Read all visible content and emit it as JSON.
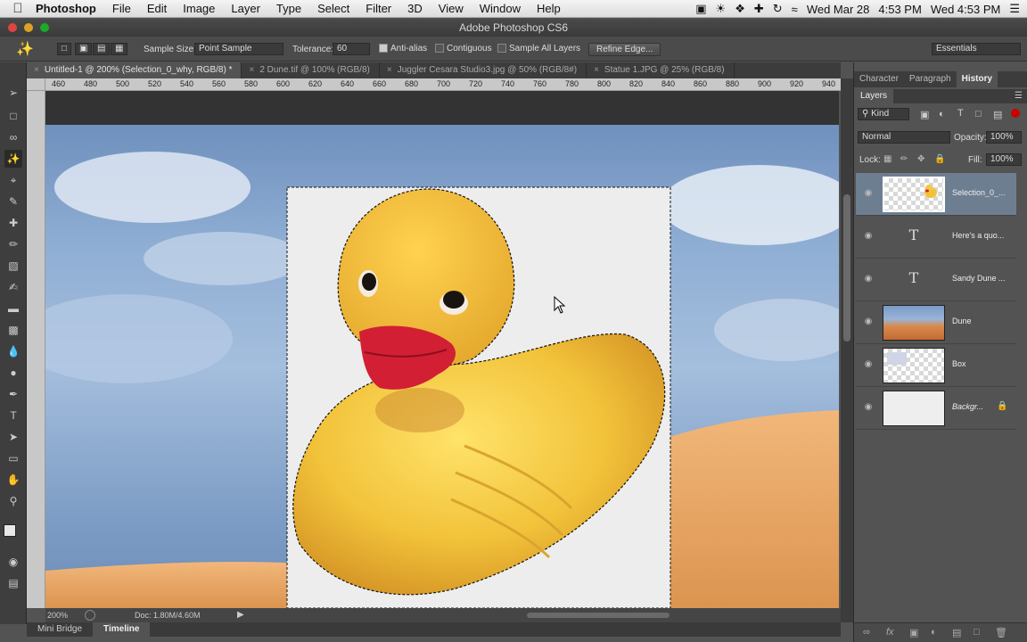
{
  "menubar": {
    "app": "Photoshop",
    "menus": [
      "File",
      "Edit",
      "Image",
      "Layer",
      "Type",
      "Select",
      "Filter",
      "3D",
      "View",
      "Window",
      "Help"
    ],
    "date1": "Wed Mar 28",
    "time1": "4:53 PM",
    "clock2": "Wed 4:53 PM"
  },
  "window": {
    "title": "Adobe Photoshop CS6"
  },
  "options": {
    "sample_size_label": "Sample Size:",
    "sample_size_value": "Point Sample",
    "tolerance_label": "Tolerance:",
    "tolerance_value": "60",
    "anti_alias": "Anti-alias",
    "contiguous": "Contiguous",
    "sample_all_layers": "Sample All Layers",
    "refine_edge": "Refine Edge...",
    "workspace": "Essentials"
  },
  "tabs": [
    {
      "label": "Untitled-1 @ 200% (Selection_0_why, RGB/8) *",
      "active": true
    },
    {
      "label": "2 Dune.tif @ 100% (RGB/8)",
      "active": false
    },
    {
      "label": "Juggler Cesara Studio3.jpg @ 50% (RGB/8#)",
      "active": false
    },
    {
      "label": "Statue 1.JPG @ 25% (RGB/8)",
      "active": false
    }
  ],
  "ruler": [
    "460",
    "480",
    "500",
    "520",
    "540",
    "560",
    "580",
    "600",
    "620",
    "640",
    "660",
    "680",
    "700",
    "720",
    "740",
    "760",
    "780",
    "800",
    "820",
    "840",
    "860",
    "880",
    "900",
    "920",
    "940"
  ],
  "status": {
    "zoom": "200%",
    "doc": "Doc: 1.80M/4.60M"
  },
  "bottom_tabs": [
    "Mini Bridge",
    "Timeline"
  ],
  "panel": {
    "tabs": [
      "Character",
      "Paragraph",
      "History"
    ],
    "layers_title": "Layers",
    "filter_kind": "Kind",
    "blend_mode": "Normal",
    "opacity_label": "Opacity:",
    "opacity_value": "100%",
    "lock_label": "Lock:",
    "fill_label": "Fill:",
    "fill_value": "100%",
    "layers": [
      {
        "name": "Selection_0_...",
        "kind": "image",
        "selected": true
      },
      {
        "name": "Here's a quo...",
        "kind": "text",
        "selected": false
      },
      {
        "name": "Sandy Dune ...",
        "kind": "text",
        "selected": false
      },
      {
        "name": "Dune",
        "kind": "image",
        "selected": false
      },
      {
        "name": "Box",
        "kind": "image",
        "selected": false
      },
      {
        "name": "Backgr...",
        "kind": "image",
        "selected": false
      }
    ]
  },
  "colors": {
    "accent_selected_layer": "#6e7e91",
    "duck_yellow": "#f2c23a",
    "beak_red": "#d21f34"
  }
}
